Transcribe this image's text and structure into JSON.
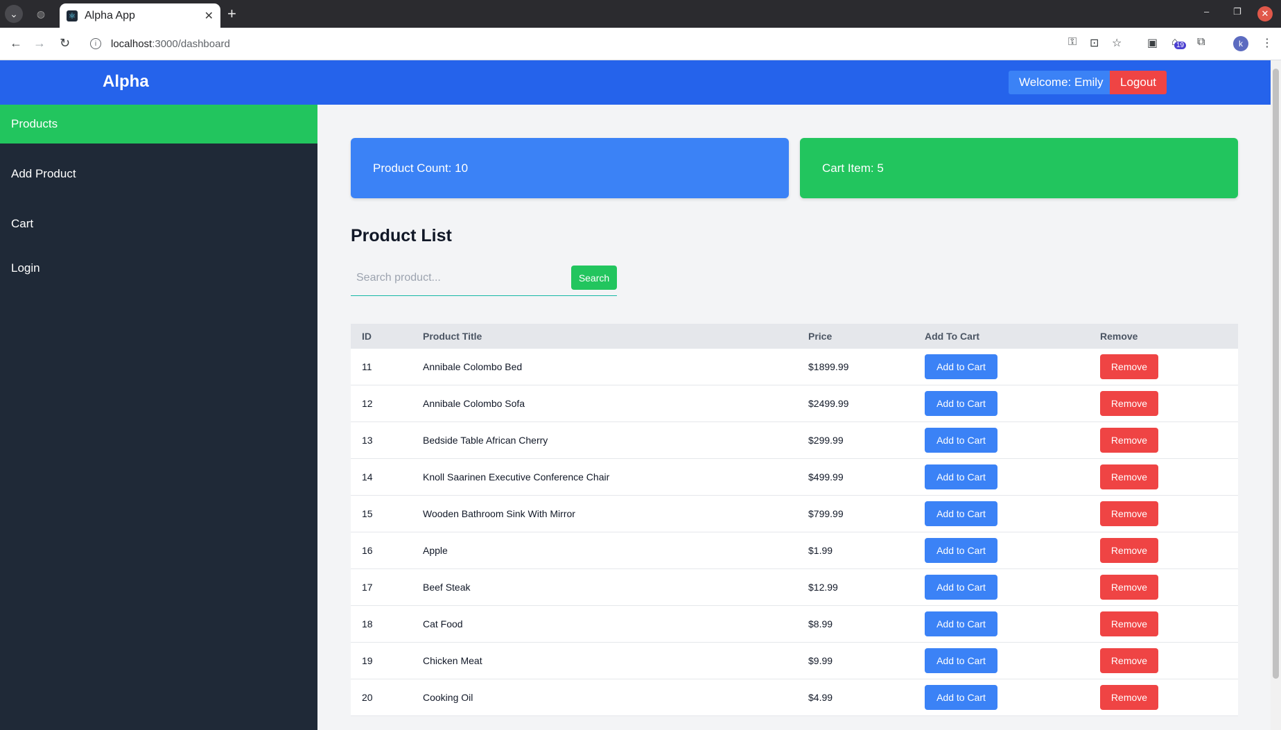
{
  "browser": {
    "tab_title": "Alpha App",
    "url_host": "localhost",
    "url_path": ":3000/dashboard",
    "extension_badge": "19",
    "profile_initial": "k"
  },
  "header": {
    "brand": "Alpha",
    "welcome": "Welcome: Emily",
    "logout": "Logout"
  },
  "sidebar": {
    "items": [
      {
        "label": "Products",
        "active": true
      },
      {
        "label": "Add Product",
        "active": false
      },
      {
        "label": "Cart",
        "active": false
      },
      {
        "label": "Login",
        "active": false
      }
    ]
  },
  "stats": {
    "product_count": "Product Count: 10",
    "cart_items": "Cart Item: 5"
  },
  "product_list": {
    "title": "Product List",
    "search_placeholder": "Search product...",
    "search_button": "Search",
    "columns": [
      "ID",
      "Product Title",
      "Price",
      "Add To Cart",
      "Remove"
    ],
    "add_label": "Add to Cart",
    "remove_label": "Remove",
    "rows": [
      {
        "id": "11",
        "title": "Annibale Colombo Bed",
        "price": "$1899.99"
      },
      {
        "id": "12",
        "title": "Annibale Colombo Sofa",
        "price": "$2499.99"
      },
      {
        "id": "13",
        "title": "Bedside Table African Cherry",
        "price": "$299.99"
      },
      {
        "id": "14",
        "title": "Knoll Saarinen Executive Conference Chair",
        "price": "$499.99"
      },
      {
        "id": "15",
        "title": "Wooden Bathroom Sink With Mirror",
        "price": "$799.99"
      },
      {
        "id": "16",
        "title": "Apple",
        "price": "$1.99"
      },
      {
        "id": "17",
        "title": "Beef Steak",
        "price": "$12.99"
      },
      {
        "id": "18",
        "title": "Cat Food",
        "price": "$8.99"
      },
      {
        "id": "19",
        "title": "Chicken Meat",
        "price": "$9.99"
      },
      {
        "id": "20",
        "title": "Cooking Oil",
        "price": "$4.99"
      }
    ]
  },
  "colors": {
    "header": "#2563eb",
    "sidebar": "#1f2937",
    "active": "#22c55e",
    "primary": "#3b82f6",
    "danger": "#ef4444"
  }
}
